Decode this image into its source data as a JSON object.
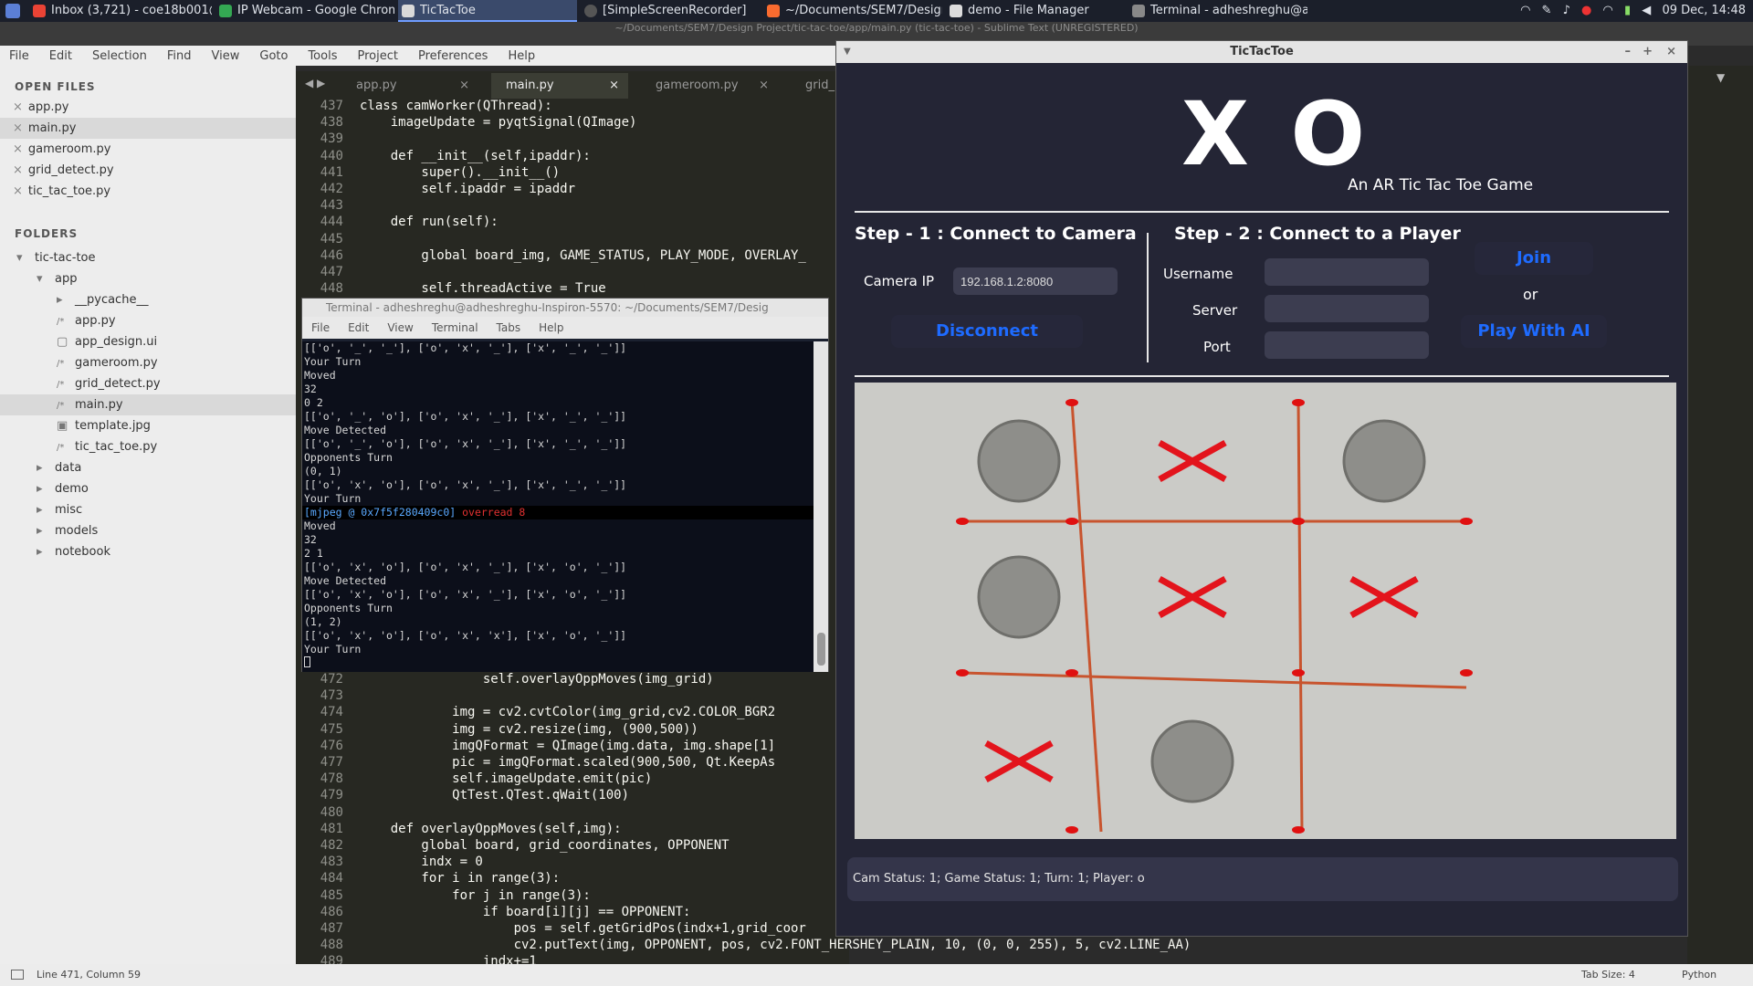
{
  "taskbar": {
    "items": [
      {
        "label": "Inbox (3,721) - coe18b001@i...",
        "color": "#ea4335"
      },
      {
        "label": "IP Webcam - Google Chrome",
        "color": "#34a853"
      },
      {
        "label": "TicTacToe",
        "color": "#d9d9d9"
      },
      {
        "label": "[SimpleScreenRecorder]",
        "color": "#666"
      },
      {
        "label": "~/Documents/SEM7/Design ...",
        "color": "#f96b2f"
      },
      {
        "label": "demo - File Manager",
        "color": "#dcdcdc"
      },
      {
        "label": "Terminal - adheshreghu@ad...",
        "color": "#888"
      }
    ],
    "clock": "09 Dec, 14:48"
  },
  "sublime": {
    "title": "~/Documents/SEM7/Design Project/tic-tac-toe/app/main.py (tic-tac-toe) - Sublime Text (UNREGISTERED)",
    "menu": [
      "File",
      "Edit",
      "Selection",
      "Find",
      "View",
      "Goto",
      "Tools",
      "Project",
      "Preferences",
      "Help"
    ],
    "open_files_header": "OPEN FILES",
    "open_files": [
      "app.py",
      "main.py",
      "gameroom.py",
      "grid_detect.py",
      "tic_tac_toe.py"
    ],
    "folders_header": "FOLDERS",
    "tree": [
      {
        "label": "tic-tac-toe",
        "depth": 0,
        "kind": "folder-open"
      },
      {
        "label": "app",
        "depth": 1,
        "kind": "folder-open"
      },
      {
        "label": "__pycache__",
        "depth": 2,
        "kind": "folder"
      },
      {
        "label": "app.py",
        "depth": 2,
        "kind": "file"
      },
      {
        "label": "app_design.ui",
        "depth": 2,
        "kind": "doc"
      },
      {
        "label": "gameroom.py",
        "depth": 2,
        "kind": "file"
      },
      {
        "label": "grid_detect.py",
        "depth": 2,
        "kind": "file"
      },
      {
        "label": "main.py",
        "depth": 2,
        "kind": "file"
      },
      {
        "label": "template.jpg",
        "depth": 2,
        "kind": "image"
      },
      {
        "label": "tic_tac_toe.py",
        "depth": 2,
        "kind": "file"
      },
      {
        "label": "data",
        "depth": 1,
        "kind": "folder"
      },
      {
        "label": "demo",
        "depth": 1,
        "kind": "folder"
      },
      {
        "label": "misc",
        "depth": 1,
        "kind": "folder"
      },
      {
        "label": "models",
        "depth": 1,
        "kind": "folder"
      },
      {
        "label": "notebook",
        "depth": 1,
        "kind": "folder"
      }
    ],
    "tabs": [
      "app.py",
      "main.py",
      "gameroom.py",
      "grid_"
    ],
    "code_top": [
      {
        "n": "437",
        "t": "class camWorker(QThread):"
      },
      {
        "n": "438",
        "t": "    imageUpdate = pyqtSignal(QImage)"
      },
      {
        "n": "439",
        "t": ""
      },
      {
        "n": "440",
        "t": "    def __init__(self,ipaddr):"
      },
      {
        "n": "441",
        "t": "        super().__init__()"
      },
      {
        "n": "442",
        "t": "        self.ipaddr = ipaddr"
      },
      {
        "n": "443",
        "t": ""
      },
      {
        "n": "444",
        "t": "    def run(self):"
      },
      {
        "n": "445",
        "t": ""
      },
      {
        "n": "446",
        "t": "        global board_img, GAME_STATUS, PLAY_MODE, OVERLAY_"
      },
      {
        "n": "447",
        "t": ""
      },
      {
        "n": "448",
        "t": "        self.threadActive = True"
      }
    ],
    "code_bottom": [
      {
        "n": "472",
        "t": "                self.overlayOppMoves(img_grid)"
      },
      {
        "n": "473",
        "t": ""
      },
      {
        "n": "474",
        "t": "            img = cv2.cvtColor(img_grid,cv2.COLOR_BGR2"
      },
      {
        "n": "475",
        "t": "            img = cv2.resize(img, (900,500))"
      },
      {
        "n": "476",
        "t": "            imgQFormat = QImage(img.data, img.shape[1]"
      },
      {
        "n": "477",
        "t": "            pic = imgQFormat.scaled(900,500, Qt.KeepAs"
      },
      {
        "n": "478",
        "t": "            self.imageUpdate.emit(pic)"
      },
      {
        "n": "479",
        "t": "            QtTest.QTest.qWait(100)"
      },
      {
        "n": "480",
        "t": ""
      },
      {
        "n": "481",
        "t": "    def overlayOppMoves(self,img):"
      },
      {
        "n": "482",
        "t": "        global board, grid_coordinates, OPPONENT"
      },
      {
        "n": "483",
        "t": "        indx = 0"
      },
      {
        "n": "484",
        "t": "        for i in range(3):"
      },
      {
        "n": "485",
        "t": "            for j in range(3):"
      },
      {
        "n": "486",
        "t": "                if board[i][j] == OPPONENT:"
      },
      {
        "n": "487",
        "t": "                    pos = self.getGridPos(indx+1,grid_coor"
      },
      {
        "n": "488",
        "t": "                    cv2.putText(img, OPPONENT, pos, cv2.FONT_HERSHEY_PLAIN, 10, (0, 0, 255), 5, cv2.LINE_AA)"
      },
      {
        "n": "489",
        "t": "                indx+=1"
      }
    ],
    "status_left": "Line 471, Column 59",
    "status_tab": "Tab Size: 4",
    "status_lang": "Python"
  },
  "terminal": {
    "title": "Terminal - adheshreghu@adheshreghu-Inspiron-5570: ~/Documents/SEM7/Desig",
    "menu": [
      "File",
      "Edit",
      "View",
      "Terminal",
      "Tabs",
      "Help"
    ],
    "lines": [
      "[['o', '_', '_'], ['o', 'x', '_'], ['x', '_', '_']]",
      "Your Turn",
      "Moved",
      "32",
      "0 2",
      "[['o', '_', 'o'], ['o', 'x', '_'], ['x', '_', '_']]",
      "Move Detected",
      "[['o', '_', 'o'], ['o', 'x', '_'], ['x', '_', '_']]",
      "Opponents Turn",
      "(0, 1)",
      "[['o', 'x', 'o'], ['o', 'x', '_'], ['x', '_', '_']]",
      "Your Turn"
    ],
    "error_prefix": "[mjpeg @ 0x7f5f280409c0] ",
    "error_msg": "overread 8",
    "lines2": [
      "Moved",
      "32",
      "2 1",
      "[['o', 'x', 'o'], ['o', 'x', '_'], ['x', 'o', '_']]",
      "Move Detected",
      "[['o', 'x', 'o'], ['o', 'x', '_'], ['x', 'o', '_']]",
      "Opponents Turn",
      "(1, 2)",
      "[['o', 'x', 'o'], ['o', 'x', 'x'], ['x', 'o', '_']]",
      "Your Turn"
    ]
  },
  "app": {
    "window_title": "TicTacToe",
    "logo": "X O",
    "subtitle": "An AR Tic Tac Toe Game",
    "step1": "Step - 1 : Connect to Camera",
    "camera_ip_label": "Camera IP",
    "camera_ip_value": "192.168.1.2:8080",
    "disconnect": "Disconnect",
    "step2": "Step - 2 : Connect to a Player",
    "username_label": "Username",
    "server_label": "Server",
    "port_label": "Port",
    "join": "Join",
    "or": "or",
    "play_ai": "Play With AI",
    "status_line": "Cam Status: 1;  Game Status: 1;  Turn: 1;  Player: o",
    "board": [
      [
        "o",
        "x",
        "o"
      ],
      [
        "o",
        "x",
        "x"
      ],
      [
        "x",
        "o",
        "_"
      ]
    ]
  }
}
